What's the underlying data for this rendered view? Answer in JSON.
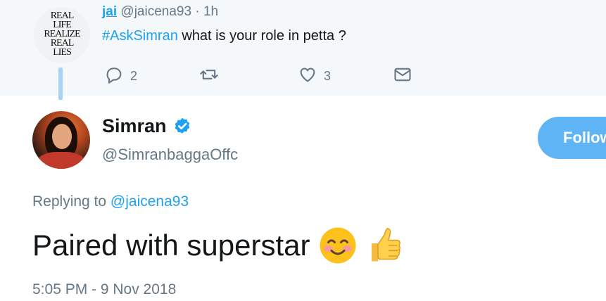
{
  "parent_tweet": {
    "avatar_lines": [
      "REAL",
      "LIFE",
      "REALIZE",
      "REAL",
      "LIES"
    ],
    "author_name": "jai",
    "author_handle": "@jaicena93",
    "separator": "·",
    "time": "1h",
    "hashtag": "#AskSimran",
    "text": " what is your role in petta ?",
    "actions": {
      "reply_icon": "reply-icon",
      "reply_count": "2",
      "retweet_icon": "retweet-icon",
      "like_icon": "heart-icon",
      "like_count": "3",
      "dm_icon": "envelope-icon"
    }
  },
  "main_tweet": {
    "author_name": "Simran",
    "verified_icon": "verified-badge-icon",
    "author_handle": "@SimranbaggaOffc",
    "follow_label": "Follow",
    "replying_prefix": "Replying to ",
    "replying_mention": "@jaicena93",
    "text": "Paired with superstar",
    "emojis": [
      "smiling-face-emoji",
      "thumbs-up-emoji"
    ],
    "timestamp": "5:05 PM - 9 Nov 2018"
  },
  "colors": {
    "accent": "#1da1f2",
    "muted": "#657786",
    "text": "#14171a",
    "parent_bg": "#f5f8fa",
    "follow_bg": "#5fb4f5",
    "thread_line": "#a5d4f7"
  }
}
